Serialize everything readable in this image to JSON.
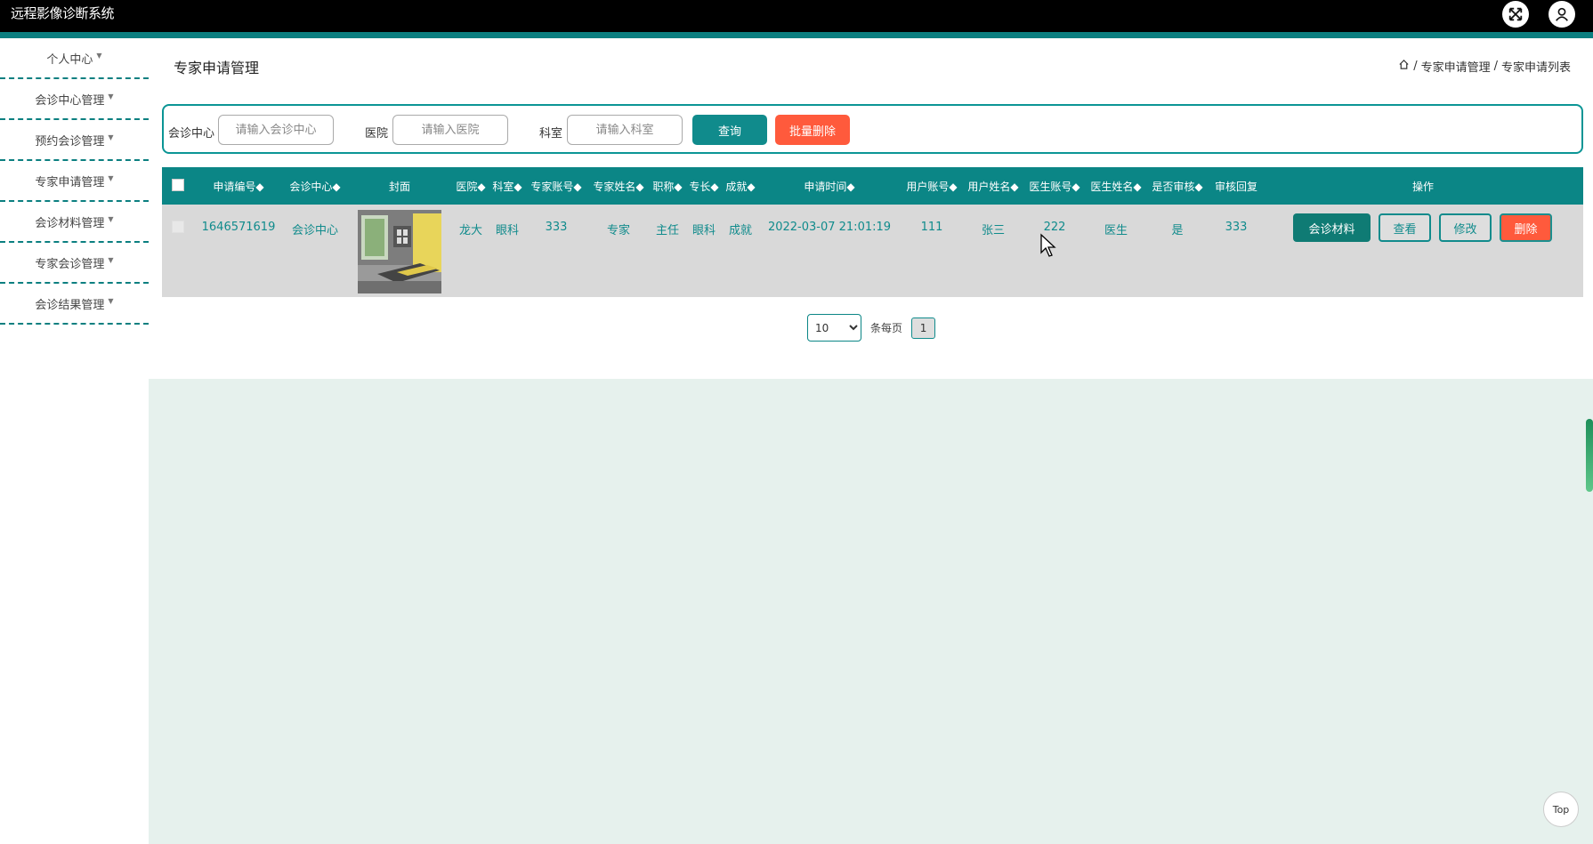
{
  "app": {
    "title": "远程影像诊断系统"
  },
  "sidebar": {
    "items": [
      {
        "label": "个人中心"
      },
      {
        "label": "会诊中心管理"
      },
      {
        "label": "预约会诊管理"
      },
      {
        "label": "专家申请管理"
      },
      {
        "label": "会诊材料管理"
      },
      {
        "label": "专家会诊管理"
      },
      {
        "label": "会诊结果管理"
      }
    ]
  },
  "page": {
    "title": "专家申请管理",
    "breadcrumb": [
      "专家申请管理",
      "专家申请列表"
    ]
  },
  "search": {
    "center_label": "会诊中心",
    "center_placeholder": "请输入会诊中心",
    "hospital_label": "医院",
    "hospital_placeholder": "请输入医院",
    "dept_label": "科室",
    "dept_placeholder": "请输入科室",
    "query_label": "查询",
    "batch_delete_label": "批量删除"
  },
  "table": {
    "headers": [
      "申请编号◆",
      "会诊中心◆",
      "封面",
      "医院◆",
      "科室◆",
      "专家账号◆",
      "专家姓名◆",
      "职称◆",
      "专长◆",
      "成就◆",
      "申请时间◆",
      "用户账号◆",
      "用户姓名◆",
      "医生账号◆",
      "医生姓名◆",
      "是否审核◆",
      "审核回复",
      "操作"
    ],
    "rows": [
      {
        "cells": [
          "1646571619",
          "会诊中心",
          "",
          "龙大",
          "眼科",
          "333",
          "专家",
          "主任",
          "眼科",
          "成就",
          "2022-03-07 21:01:19",
          "111",
          "张三",
          "222",
          "医生",
          "是",
          "333"
        ],
        "actions": [
          "会诊材料",
          "查看",
          "修改",
          "删除"
        ]
      }
    ]
  },
  "pager": {
    "page_size": "10",
    "page_size_options": [
      "10"
    ],
    "per_page_label": "条每页",
    "current_page": "1"
  },
  "misc": {
    "top_label": "Top"
  },
  "colors": {
    "accent": "#0b8686",
    "danger": "#ff5a3c",
    "content_bg": "#e6f1ed"
  }
}
